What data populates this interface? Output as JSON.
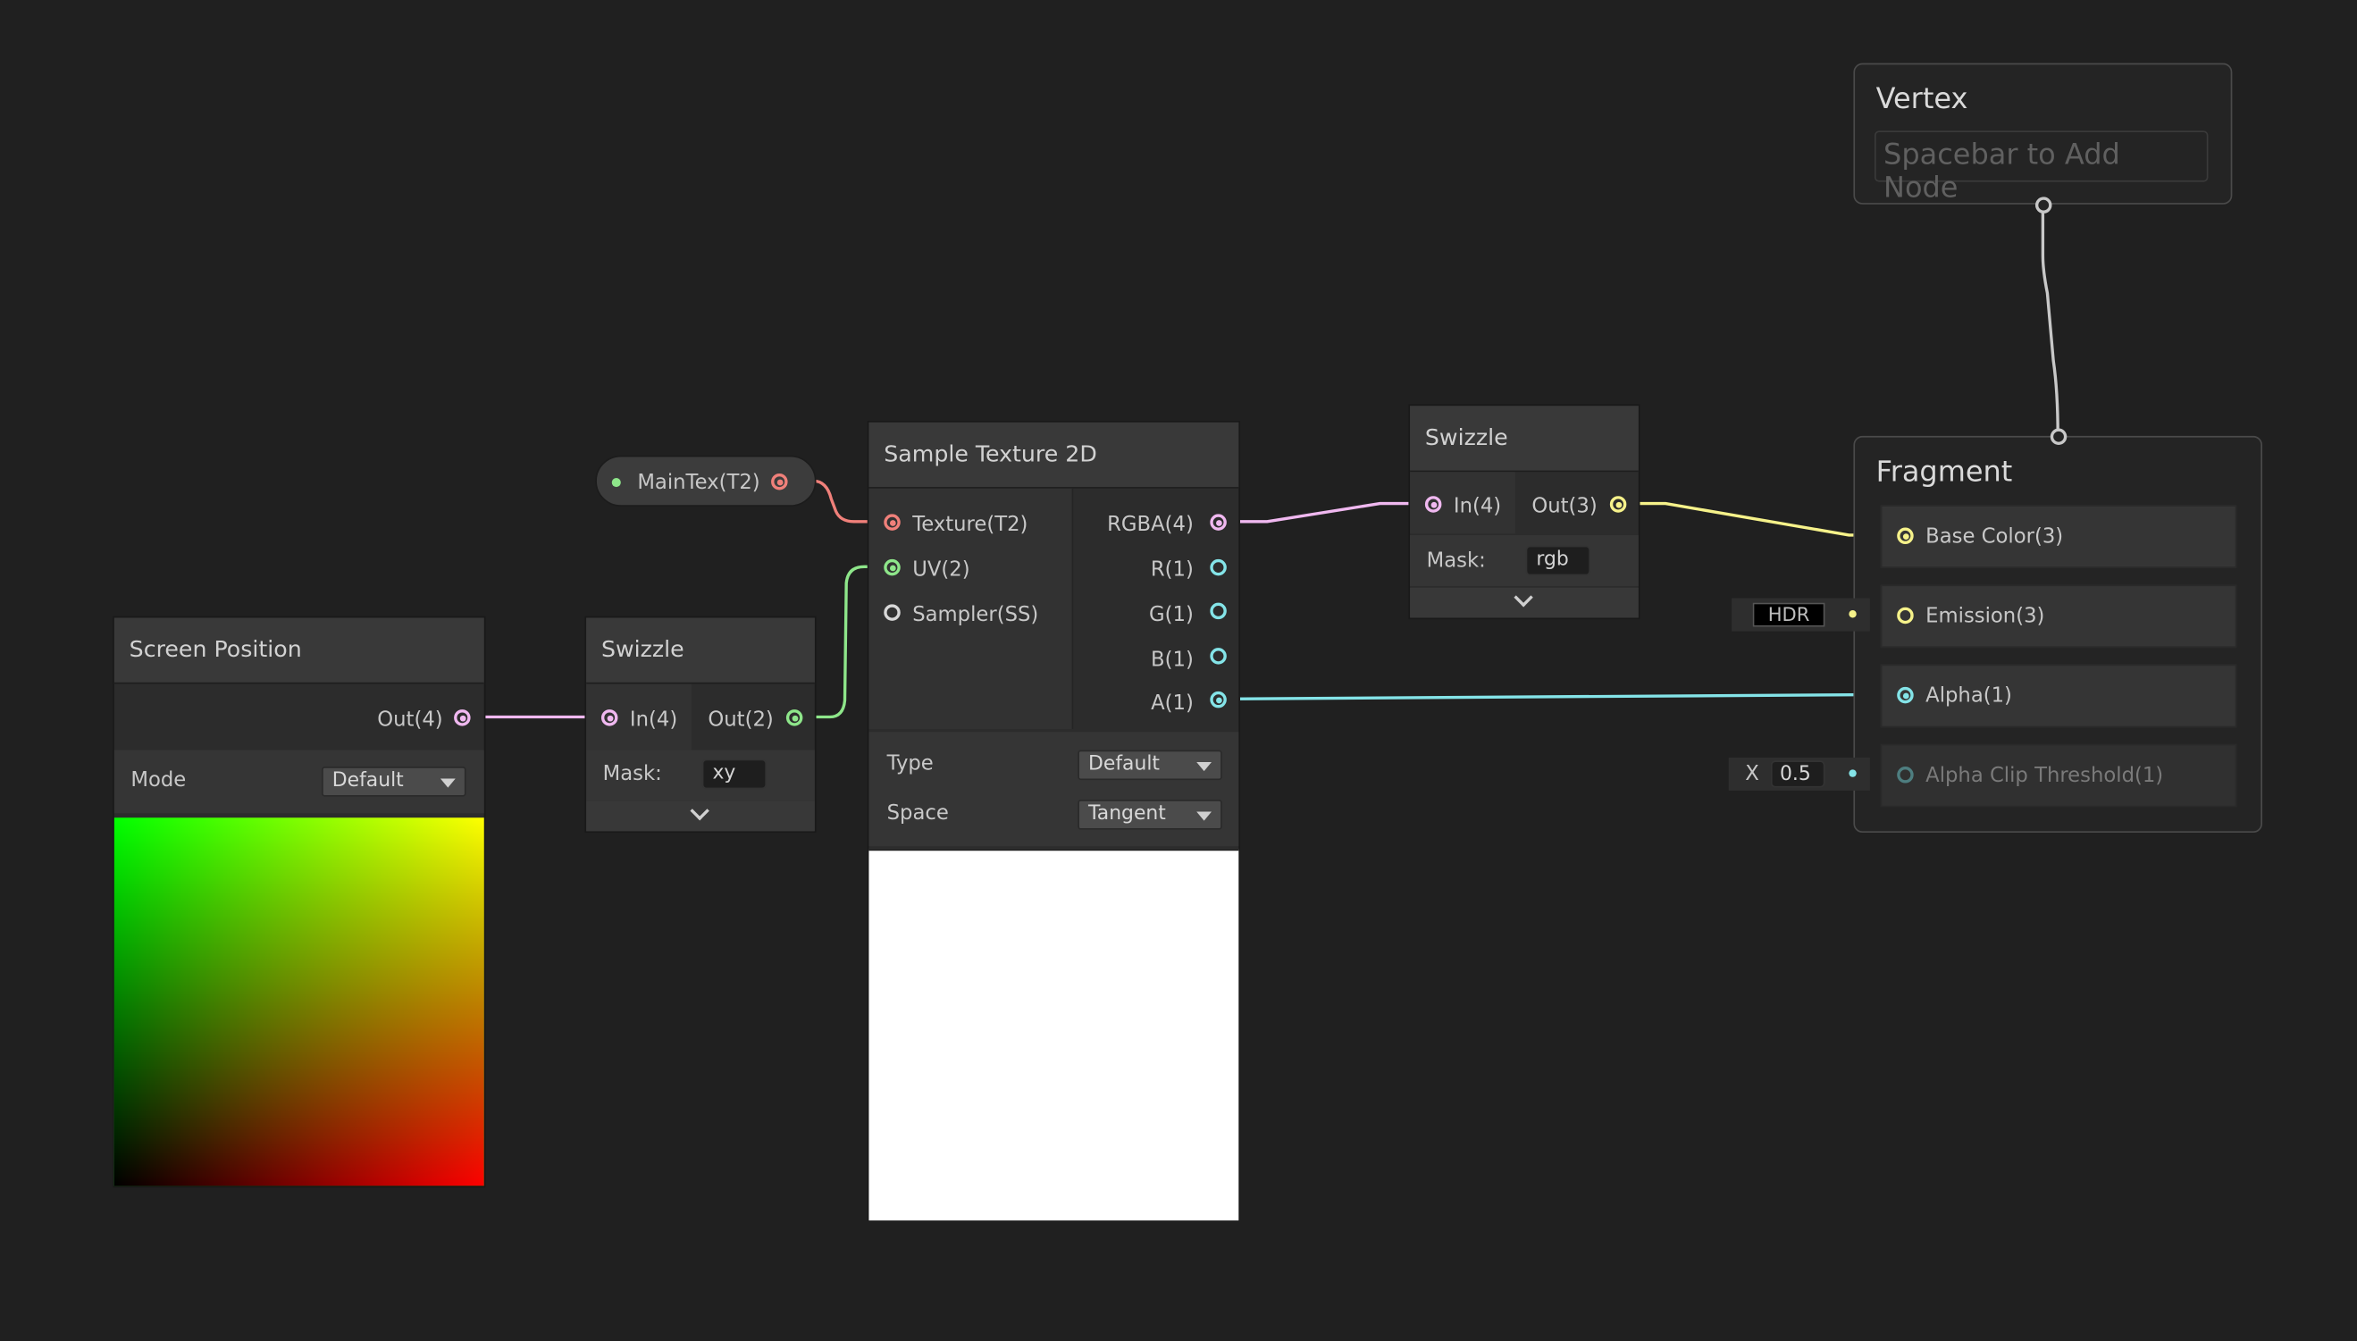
{
  "vertex": {
    "title": "Vertex",
    "placeholder": "Spacebar to Add Node"
  },
  "fragment": {
    "title": "Fragment",
    "slots": [
      "Base Color(3)",
      "Emission(3)",
      "Alpha(1)",
      "Alpha Clip Threshold(1)"
    ]
  },
  "hdr_field": {
    "label": "HDR"
  },
  "alpha_clip_field": {
    "axis": "X",
    "value": "0.5"
  },
  "property": {
    "label": "MainTex(T2)"
  },
  "screen_position": {
    "title": "Screen Position",
    "output": "Out(4)",
    "mode_label": "Mode",
    "mode_value": "Default"
  },
  "swizzle1": {
    "title": "Swizzle",
    "input": "In(4)",
    "output": "Out(2)",
    "mask_label": "Mask:",
    "mask_value": "xy"
  },
  "sample_texture": {
    "title": "Sample Texture 2D",
    "inputs": [
      "Texture(T2)",
      "UV(2)",
      "Sampler(SS)"
    ],
    "outputs": [
      "RGBA(4)",
      "R(1)",
      "G(1)",
      "B(1)",
      "A(1)"
    ],
    "type_label": "Type",
    "type_value": "Default",
    "space_label": "Space",
    "space_value": "Tangent"
  },
  "swizzle2": {
    "title": "Swizzle",
    "input": "In(4)",
    "output": "Out(3)",
    "mask_label": "Mask:",
    "mask_value": "rgb"
  },
  "colors": {
    "background": "#202020",
    "vector4": "#f0b8f0",
    "vector3": "#f6f28a",
    "vector2": "#8ee68a",
    "vector1": "#84e4e8",
    "texture": "#f0807a",
    "sampler": "#d8d8d8"
  }
}
